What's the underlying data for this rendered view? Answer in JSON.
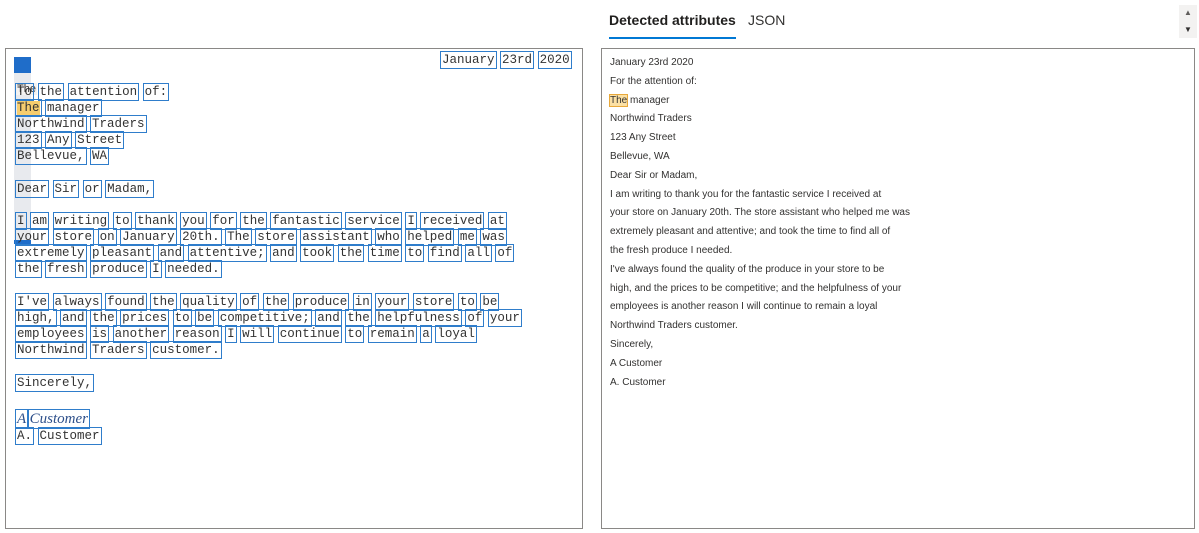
{
  "tabs": {
    "detected": "Detected attributes",
    "json": "JSON"
  },
  "scroll": {
    "up": "▲",
    "down": "▼"
  },
  "doc": {
    "header_label": "The",
    "date_words": [
      "January",
      "23rd",
      "2020"
    ],
    "lines": [
      [
        "To",
        "the",
        "attention",
        "of:"
      ],
      [
        "The",
        "manager"
      ],
      [
        "Northwind",
        "Traders"
      ],
      [
        "123",
        "Any",
        "Street"
      ],
      [
        "Bellevue,",
        "WA"
      ],
      [
        "Dear",
        "Sir",
        "or",
        "Madam,"
      ],
      [
        "I",
        "am",
        "writing",
        "to",
        "thank",
        "you",
        "for",
        "the",
        "fantastic",
        "service",
        "I",
        "received",
        "at"
      ],
      [
        "your",
        "store",
        "on",
        "January",
        "20th.",
        "The",
        "store",
        "assistant",
        "who",
        "helped",
        "me",
        "was"
      ],
      [
        "extremely",
        "pleasant",
        "and",
        "attentive;",
        "and",
        "took",
        "the",
        "time",
        "to",
        "find",
        "all",
        "of"
      ],
      [
        "the",
        "fresh",
        "produce",
        "I",
        "needed."
      ],
      [
        "I've",
        "always",
        "found",
        "the",
        "quality",
        "of",
        "the",
        "produce",
        "in",
        "your",
        "store",
        "to",
        "be"
      ],
      [
        "high,",
        "and",
        "the",
        "prices",
        "to",
        "be",
        "competitive;",
        "and",
        "the",
        "helpfulness",
        "of",
        "your"
      ],
      [
        "employees",
        "is",
        "another",
        "reason",
        "I",
        "will",
        "continue",
        "to",
        "remain",
        "a",
        "loyal"
      ],
      [
        "Northwind",
        "Traders",
        "customer."
      ],
      [
        "Sincerely,"
      ],
      [
        "A",
        "Customer"
      ],
      [
        "A.",
        "Customer"
      ]
    ]
  },
  "panel_lines": [
    "January 23rd 2020",
    "For the attention of:",
    "The manager",
    "Northwind Traders",
    "123 Any Street",
    "Bellevue, WA",
    "Dear Sir or Madam,",
    "I am writing to thank you for the fantastic service I received at",
    "your store on January 20th. The store assistant who helped me was",
    "extremely pleasant and attentive; and took the time to find all of",
    "the fresh produce I needed.",
    "I've always found the quality of the produce in your store to be",
    "high, and the prices to be competitive; and the helpfulness of your",
    "employees is another reason I will continue to remain a loyal",
    "Northwind Traders customer.",
    "Sincerely,",
    "A Customer",
    "A. Customer"
  ],
  "highlight_word": "The",
  "colors": {
    "box": "#2f7dcb",
    "highlight": "#f6cd6e",
    "tab_accent": "#0078d4"
  }
}
